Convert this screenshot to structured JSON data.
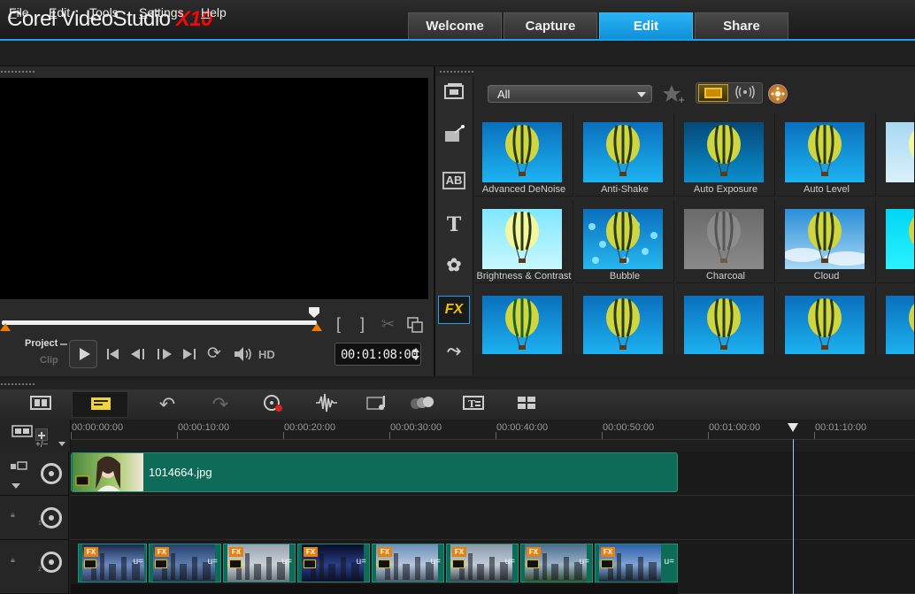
{
  "app": {
    "title_main": "Corel VideoStudio ",
    "title_version": "X10"
  },
  "workspace_tabs": [
    {
      "label": "Welcome",
      "active": false
    },
    {
      "label": "Capture",
      "active": false
    },
    {
      "label": "Edit",
      "active": true
    },
    {
      "label": "Share",
      "active": false
    }
  ],
  "menu": [
    {
      "label": "File",
      "mnemonic": "F",
      "rest": "ile"
    },
    {
      "label": "Edit",
      "mnemonic": "E",
      "rest": "dit"
    },
    {
      "label": "Tools",
      "mnemonic": "T",
      "rest": "ools"
    },
    {
      "label": "Settings",
      "mnemonic": "S",
      "rest": "ettings"
    },
    {
      "label": "Help",
      "mnemonic": "H",
      "rest": "elp"
    }
  ],
  "player": {
    "mode_project": "Project",
    "mode_clip": "Clip",
    "hd_label": "HD",
    "timecode": "00:01:08:00",
    "mark_in": "[",
    "mark_out": "]"
  },
  "library": {
    "filter_value": "All",
    "sidebar": [
      {
        "name": "media-icon",
        "glyph": "▦"
      },
      {
        "name": "instant-project-icon",
        "glyph": "✧"
      },
      {
        "name": "transition-icon",
        "glyph": "AB"
      },
      {
        "name": "title-icon",
        "glyph": "T"
      },
      {
        "name": "graphic-icon",
        "glyph": "✿"
      },
      {
        "name": "filter-fx-icon",
        "glyph": "FX"
      },
      {
        "name": "path-icon",
        "glyph": "⤳"
      }
    ],
    "effects": [
      {
        "label": "Advanced DeNoise",
        "style": "normal"
      },
      {
        "label": "Anti-Shake",
        "style": "normal"
      },
      {
        "label": "Auto Exposure",
        "style": "dark"
      },
      {
        "label": "Auto Level",
        "style": "normal"
      },
      {
        "label": "Au",
        "style": "pale"
      },
      {
        "label": "Brightness & Contrast",
        "style": "bright"
      },
      {
        "label": "Bubble",
        "style": "bubble"
      },
      {
        "label": "Charcoal",
        "style": "charcoal"
      },
      {
        "label": "Cloud",
        "style": "cloud"
      },
      {
        "label": "Colo",
        "style": "cyan"
      },
      {
        "label": "",
        "style": "green"
      },
      {
        "label": "",
        "style": "normal"
      },
      {
        "label": "",
        "style": "normal"
      },
      {
        "label": "",
        "style": "normal"
      },
      {
        "label": "",
        "style": "normal"
      }
    ]
  },
  "timeline": {
    "ruler": [
      "00:00:00:00",
      "00:00:10:00",
      "00:00:20:00",
      "00:00:30:00",
      "00:00:40:00",
      "00:00:50:00",
      "00:01:00:00",
      "00:01:10:00"
    ],
    "zoom_controls": "+/−",
    "video_clip": {
      "name": "1014664.jpg"
    },
    "overlay_track_number_1": "1",
    "overlay_track_number_2": "2",
    "fx_badge": "FX"
  }
}
